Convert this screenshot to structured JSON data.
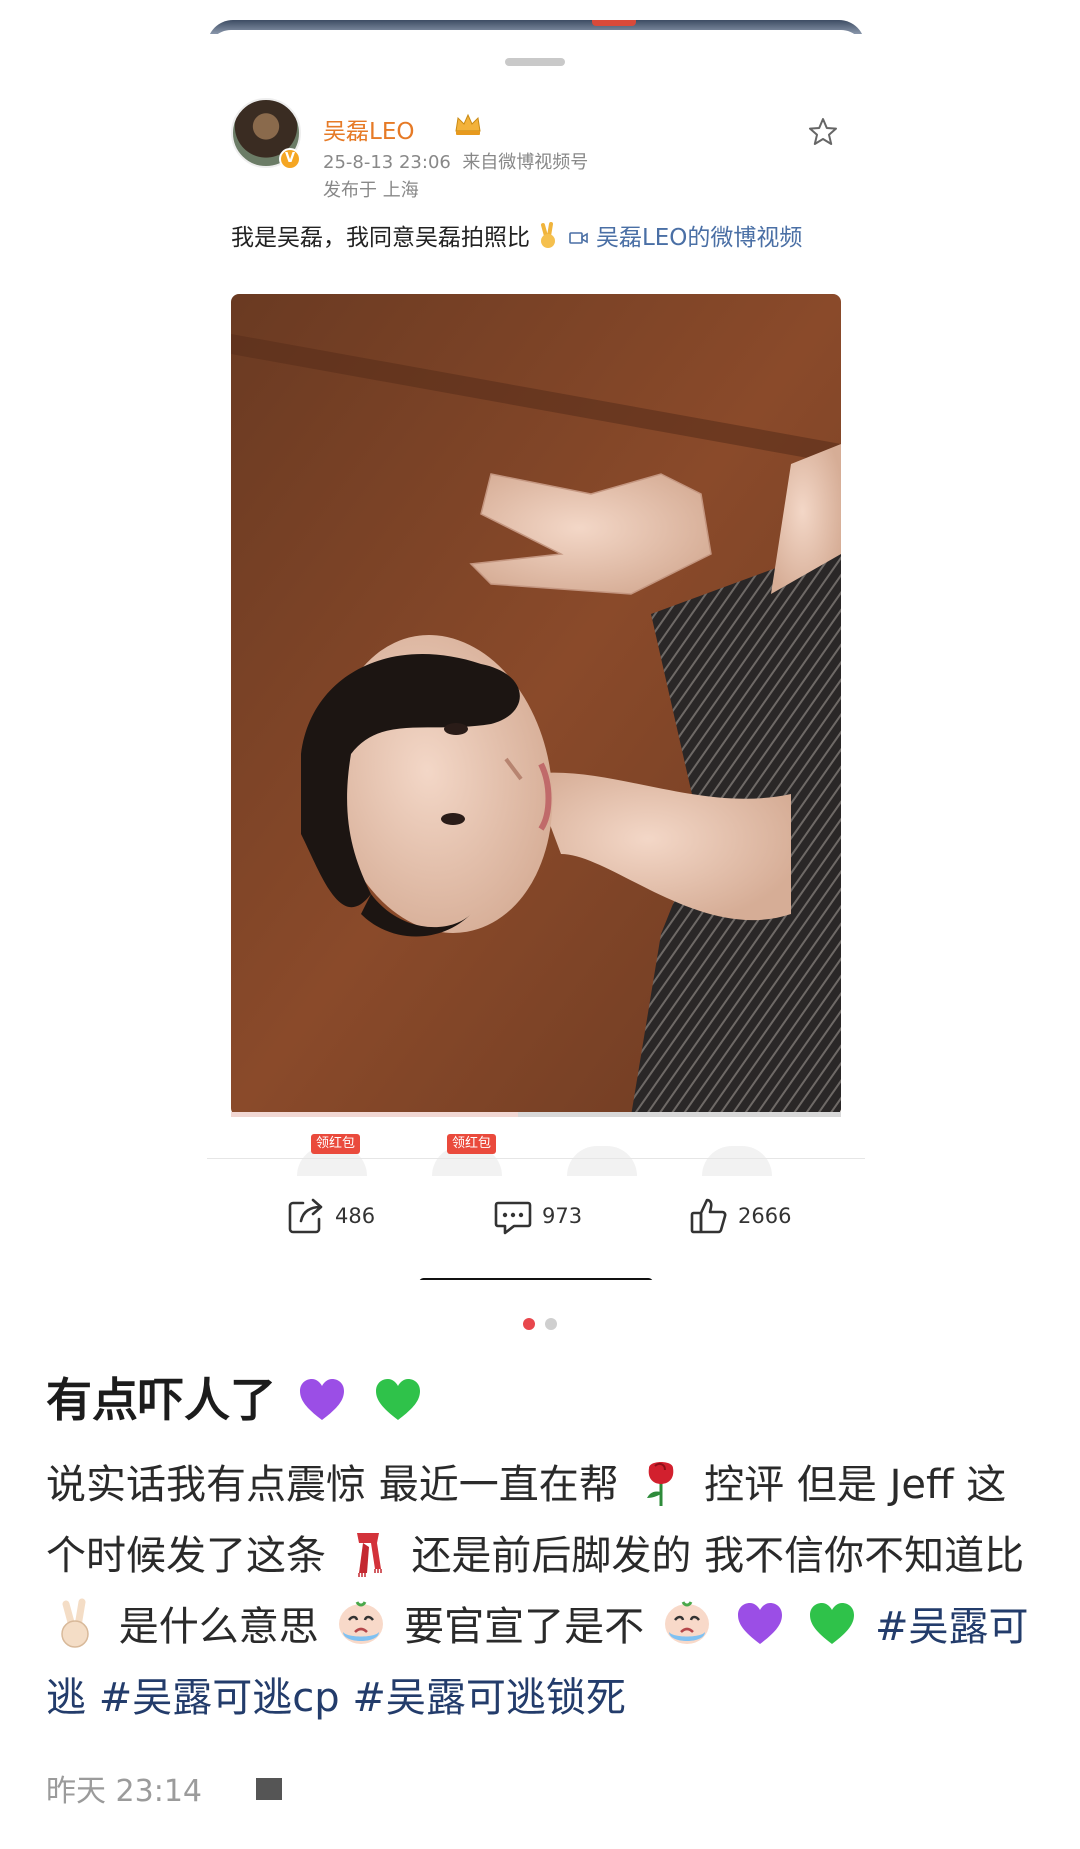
{
  "weibo_post": {
    "username": "吴磊LEO",
    "datetime": "25-8-13 23:06",
    "source": "来自微博视频号",
    "location": "发布于 上海",
    "text": "我是吴磊，我同意吴磊拍照比",
    "video_link": "吴磊LEO的微博视频",
    "video_progress": 0.47,
    "reward_tag_1": "领红包",
    "reward_tag_2": "领红包",
    "verified_badge": "V",
    "actions": {
      "repost_count": "486",
      "comment_count": "973",
      "like_count": "2666"
    }
  },
  "pager": {
    "pages": 2,
    "active": 1
  },
  "caption": {
    "title": "有点吓人了",
    "body_1": "说实话我有点震惊 最近一直在帮",
    "body_2": "控评 但是 Jeff 这个时候发了这条",
    "body_3": "还是前后脚发的 我不信你不知道比",
    "body_4": "是什么意思",
    "body_5": "要官宣了是不",
    "tags": [
      "#吴露可逃",
      "#吴露可逃cp",
      "#吴露可逃锁死"
    ],
    "timestamp": "昨天 23:14"
  },
  "colors": {
    "username": "#e67a26",
    "link": "#4a6fa5",
    "hashtag": "#233c6b",
    "active_dot": "#e8474d",
    "reward_tag": "#ea4a3c"
  },
  "icons": [
    "crown-icon",
    "star-icon",
    "video-icon",
    "share-icon",
    "comment-icon",
    "like-icon",
    "victory-hand-icon",
    "purple-heart-icon",
    "green-heart-icon",
    "rose-icon",
    "scarf-icon",
    "crying-face-icon"
  ]
}
